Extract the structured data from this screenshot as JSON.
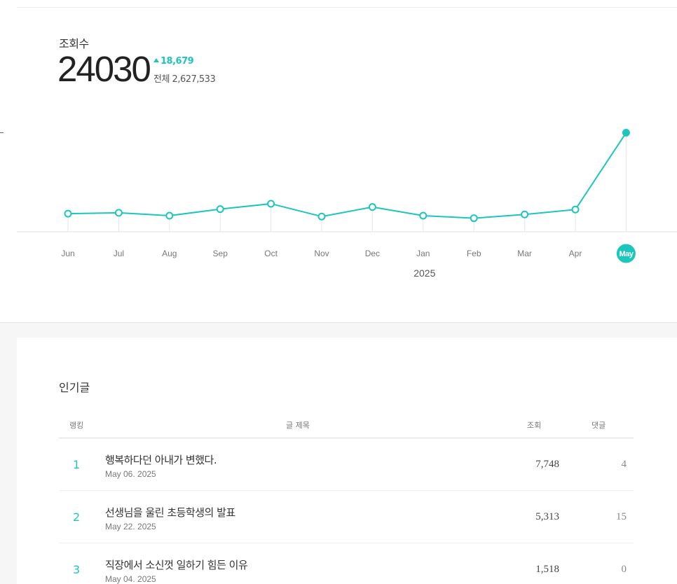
{
  "stats": {
    "label": "조회수",
    "value": "24030",
    "delta": "18,679",
    "total": "전체 2,627,533"
  },
  "chart_data": {
    "type": "line",
    "categories": [
      "Jun",
      "Jul",
      "Aug",
      "Sep",
      "Oct",
      "Nov",
      "Dec",
      "Jan",
      "Feb",
      "Mar",
      "Apr",
      "May"
    ],
    "year_label": "2025",
    "year_label_under": "Jan",
    "values": [
      4400,
      4600,
      3900,
      5500,
      6800,
      3700,
      6000,
      3900,
      3300,
      4200,
      5400,
      24030
    ],
    "highlight_index": 11,
    "ylim": [
      0,
      27000
    ],
    "color": "#1dc6bc"
  },
  "popular": {
    "title": "인기글",
    "headers": {
      "rank": "랭킹",
      "title": "글 제목",
      "views": "조회",
      "comments": "댓글"
    },
    "rows": [
      {
        "rank": "1",
        "title": "행복하다던 아내가 변했다.",
        "date": "May 06. 2025",
        "views": "7,748",
        "comments": "4"
      },
      {
        "rank": "2",
        "title": "선생님을 울린 초등학생의 발표",
        "date": "May 22. 2025",
        "views": "5,313",
        "comments": "15"
      },
      {
        "rank": "3",
        "title": "직장에서 소신껏 일하기 힘든 이유",
        "date": "May 04. 2025",
        "views": "1,518",
        "comments": "0"
      }
    ]
  }
}
